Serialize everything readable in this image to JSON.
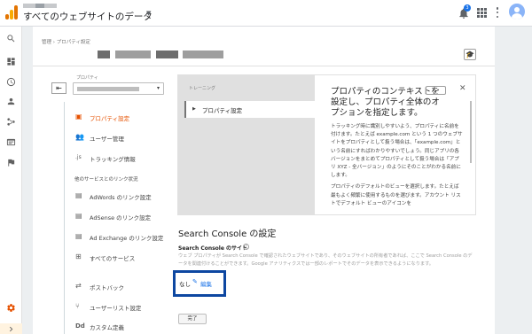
{
  "topbar": {
    "title": "すべてのウェブサイトのデータ",
    "notification_count": "3"
  },
  "breadcrumb": "管理 › プロパティ設定",
  "sidebar": {
    "property_label": "プロパティ",
    "section_label": "他のサービスとのリンク状況",
    "items": [
      {
        "label": "プロパティ設定",
        "icon": "document-icon",
        "active": true
      },
      {
        "label": "ユーザー管理",
        "icon": "people-icon"
      },
      {
        "label": "トラッキング情報",
        "icon": "js-icon"
      },
      {
        "label": "AdWords のリンク設定",
        "icon": "adwords-icon"
      },
      {
        "label": "AdSense のリンク設定",
        "icon": "adsense-icon"
      },
      {
        "label": "Ad Exchange のリンク設定",
        "icon": "adexchange-icon"
      },
      {
        "label": "すべてのサービス",
        "icon": "all-products-icon"
      },
      {
        "label": "ポストバック",
        "icon": "postback-icon"
      },
      {
        "label": "ユーザーリスト設定",
        "icon": "user-list-icon"
      },
      {
        "label": "カスタム定義",
        "icon": "dd-icon"
      }
    ]
  },
  "training": {
    "header": "トレーニング",
    "item": "プロパティ設定",
    "title": "プロパティのコンテキストを設定し、プロパティ全体のオプションを指定します。",
    "paragraph1": "トラッキング時に識別しやすいよう、プロパティに名前を付けます。たとえば example.com という 1 つのウェブサイトをプロパティとして扱う場合は、「example.com」という名前にすればわかりやすいでしょう。同じアプリの各バージョンをまとめてプロパティとして扱う場合は「アプリ XYZ - 全バージョン」のようにそのことがわかる名前にします。",
    "paragraph2": "プロパティのデフォルトのビューを選択します。たとえば最もよく頻繁に使用するものを選びます。アカウント リストでデフォルト ビューのアイコンを"
  },
  "search_console": {
    "section_title": "Search Console の設定",
    "site_label": "Search Console のサイト",
    "description": "ウェブ プロパティが Search Console で確認されたウェブサイトであり、そのウェブサイトの所有者であれば、ここで Search Console のデータを関連付けることができます。Google アナリティクスでは一部のレポートでそのデータを表示できるようになります。",
    "none_label": "なし",
    "edit_label": "編集"
  },
  "done_label": "完了",
  "colors": {
    "accent": "#e65100",
    "highlight_box": "#0d47a1",
    "link": "#1a73e8"
  }
}
